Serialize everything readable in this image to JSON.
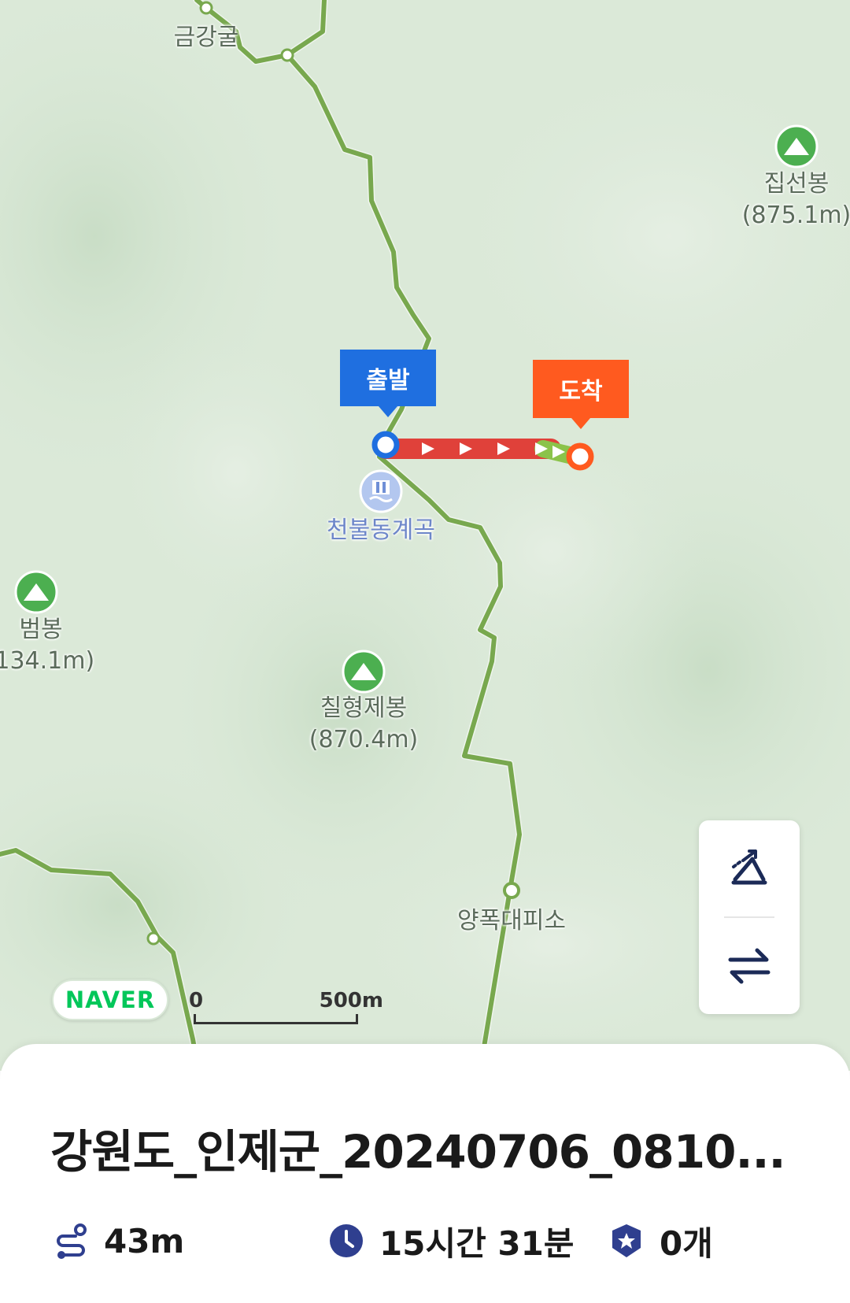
{
  "map": {
    "places": [
      {
        "name": "금강굴",
        "elevation": ""
      },
      {
        "name": "집선봉",
        "elevation": "(875.1m)"
      },
      {
        "name": "범봉",
        "elevation": ",134.1m)"
      },
      {
        "name": "칠형제봉",
        "elevation": "(870.4m)"
      },
      {
        "name": "천불동계곡",
        "elevation": ""
      },
      {
        "name": "양폭대피소",
        "elevation": ""
      }
    ],
    "start_label": "출발",
    "end_label": "도착",
    "provider": "NAVER",
    "scale": {
      "zero": "0",
      "distance": "500m"
    },
    "colors": {
      "trail": "#78a84e",
      "route": "#e0413a",
      "start": "#1f6fe0",
      "end": "#ff5a1f",
      "peak": "#4caf50"
    }
  },
  "controls": {
    "elevation_icon": "elevation-chart-icon",
    "swap_icon": "swap-direction-icon"
  },
  "sheet": {
    "title": "강원도_인제군_20240706_0810...",
    "distance": "43m",
    "duration": "15시간 31분",
    "badges": "0개"
  }
}
